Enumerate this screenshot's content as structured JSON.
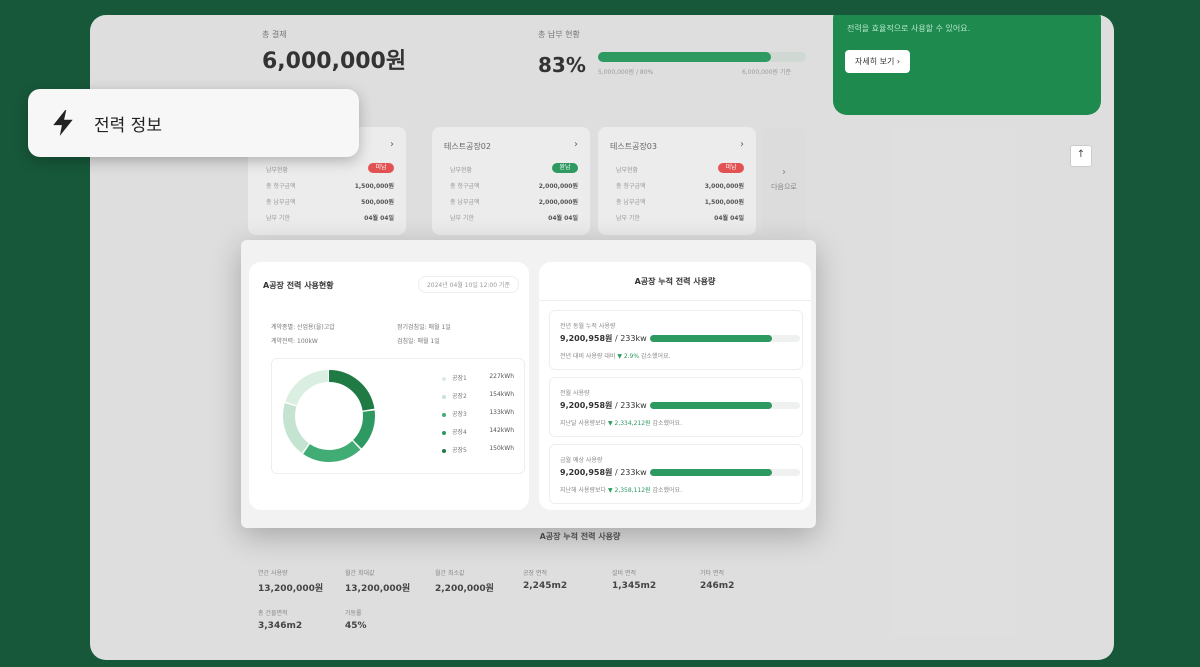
{
  "backdrop": {
    "total_payment_label": "총 결제",
    "total_payment_value": "6,000,000원",
    "usage_rate_label": "총 납부 현황",
    "usage_rate_value": "83%",
    "usage_rate_fraction": 0.83,
    "bar_left_caption": "5,000,000원 / 80%",
    "bar_right_caption": "6,000,000원 기준",
    "promo_text": "전력을 효율적으로 사용할 수 있어요.",
    "promo_button": "자세히 보기 ›",
    "cards": [
      {
        "title": "",
        "badge": "미납",
        "badge_color": "#e25252",
        "rows": [
          [
            "납부현황",
            ""
          ],
          [
            "총 청구금액",
            "1,500,000원"
          ],
          [
            "총 납부금액",
            "500,000원"
          ],
          [
            "납부 기한",
            "04월 04일"
          ]
        ]
      },
      {
        "title": "테스트공장02",
        "badge": "완납",
        "badge_color": "#2e9960",
        "rows": [
          [
            "납부현황",
            ""
          ],
          [
            "총 청구금액",
            "2,000,000원"
          ],
          [
            "총 납부금액",
            "2,000,000원"
          ],
          [
            "납부 기한",
            "04월 04일"
          ]
        ]
      },
      {
        "title": "테스트공장03",
        "badge": "미납",
        "badge_color": "#e25252",
        "rows": [
          [
            "납부현황",
            ""
          ],
          [
            "총 청구금액",
            "3,000,000원"
          ],
          [
            "총 납부금액",
            "1,500,000원"
          ],
          [
            "납부 기한",
            "04월 04일"
          ]
        ]
      }
    ],
    "next_label": "다음으로",
    "bottom_title": "A공장 누적 전력 사용량",
    "bottom_stats": [
      {
        "label": "연간 사용량",
        "value": "13,200,000원"
      },
      {
        "label": "월간 최대값",
        "value": "13,200,000원"
      },
      {
        "label": "월간 최소값",
        "value": "2,200,000원"
      },
      {
        "label": "공장 면적",
        "value": "2,245m2"
      },
      {
        "label": "설비 면적",
        "value": "1,345m2"
      },
      {
        "label": "기타 면적",
        "value": "246m2"
      },
      {
        "label": "총 건물면적",
        "value": "3,346m2"
      },
      {
        "label": "가동률",
        "value": "45%"
      }
    ],
    "up_icon": "up-arrow-icon"
  },
  "tooltip": {
    "icon": "lightning-bolt-icon",
    "label": "전력 정보"
  },
  "panel": {
    "left": {
      "title": "A공장 전력 사용현황",
      "date": "2024년 04월 10일 12:00 기준",
      "info": {
        "contract_type": "계약종별: 산업용(을)고압",
        "contract_power": "계약전력: 100kW",
        "meter_read": "검침일: 매월 1일",
        "meter_label": "정기검침일: 매월 1일"
      },
      "donut": {
        "segments": [
          {
            "name": "공장1",
            "value": 23,
            "color": "#1f7a44"
          },
          {
            "name": "공장2",
            "value": 15,
            "color": "#2e9960"
          },
          {
            "name": "공장3",
            "value": 22,
            "color": "#41ad74"
          },
          {
            "name": "공장4",
            "value": 20,
            "color": "#c5e3d1"
          },
          {
            "name": "공장5",
            "value": 20,
            "color": "#daeee2"
          }
        ]
      },
      "legend": [
        {
          "label": "공장1",
          "value": "227kWh",
          "color": "#daeee2"
        },
        {
          "label": "공장2",
          "value": "154kWh",
          "color": "#c5e3d1"
        },
        {
          "label": "공장3",
          "value": "133kWh",
          "color": "#41ad74"
        },
        {
          "label": "공장4",
          "value": "142kWh",
          "color": "#2e9960"
        },
        {
          "label": "공장5",
          "value": "150kWh",
          "color": "#1f7a44"
        }
      ]
    },
    "right": {
      "title": "A공장 누적 전력 사용량",
      "usages": [
        {
          "label": "전년 동월 누적 사용량",
          "value": "9,200,958원",
          "unit": " / 233kw",
          "fill": 0.81,
          "note_prefix": "전년 대비 사용량 대비 ",
          "note_change": "▼ 2.9%",
          "note_suffix": " 감소했어요."
        },
        {
          "label": "전월 사용량",
          "value": "9,200,958원",
          "unit": " / 233kw",
          "fill": 0.81,
          "note_prefix": "지난달 사용량보다 ",
          "note_change": "▼ 2,334,212원",
          "note_suffix": " 감소했어요."
        },
        {
          "label": "금월 예상 사용량",
          "value": "9,200,958원",
          "unit": " / 233kw",
          "fill": 0.81,
          "note_prefix": "지난해 사용량보다 ",
          "note_change": "▼ 2,358,112원",
          "note_suffix": " 감소했어요."
        }
      ]
    }
  }
}
